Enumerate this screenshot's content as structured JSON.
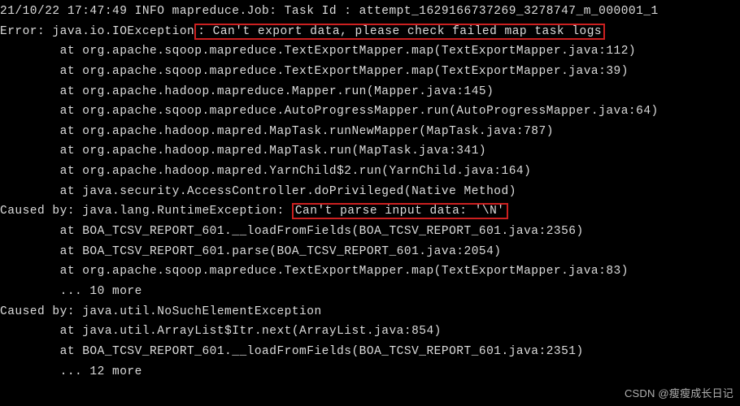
{
  "lines": {
    "l0": "21/10/22 17:47:49 INFO mapreduce.Job: Task Id : attempt_1629166737269_3278747_m_000001_1",
    "l1a": "Error: java.io.IOException",
    "l1b": ": Can't export data, please check failed map task logs",
    "l2": "        at org.apache.sqoop.mapreduce.TextExportMapper.map(TextExportMapper.java:112)",
    "l3": "        at org.apache.sqoop.mapreduce.TextExportMapper.map(TextExportMapper.java:39)",
    "l4": "        at org.apache.hadoop.mapreduce.Mapper.run(Mapper.java:145)",
    "l5": "        at org.apache.sqoop.mapreduce.AutoProgressMapper.run(AutoProgressMapper.java:64)",
    "l6": "        at org.apache.hadoop.mapred.MapTask.runNewMapper(MapTask.java:787)",
    "l7": "        at org.apache.hadoop.mapred.MapTask.run(MapTask.java:341)",
    "l8": "        at org.apache.hadoop.mapred.YarnChild$2.run(YarnChild.java:164)",
    "l9": "        at java.security.AccessController.doPrivileged(Native Method)",
    "l10a": "Caused by: java.lang.RuntimeException: ",
    "l10b": "Can't parse input data: '\\N'",
    "l11": "        at BOA_TCSV_REPORT_601.__loadFromFields(BOA_TCSV_REPORT_601.java:2356)",
    "l12": "        at BOA_TCSV_REPORT_601.parse(BOA_TCSV_REPORT_601.java:2054)",
    "l13": "        at org.apache.sqoop.mapreduce.TextExportMapper.map(TextExportMapper.java:83)",
    "l14": "        ... 10 more",
    "l15": "Caused by: java.util.NoSuchElementException",
    "l16": "        at java.util.ArrayList$Itr.next(ArrayList.java:854)",
    "l17": "        at BOA_TCSV_REPORT_601.__loadFromFields(BOA_TCSV_REPORT_601.java:2351)",
    "l18": "        ... 12 more"
  },
  "watermark": "CSDN @瘦瘦成长日记"
}
